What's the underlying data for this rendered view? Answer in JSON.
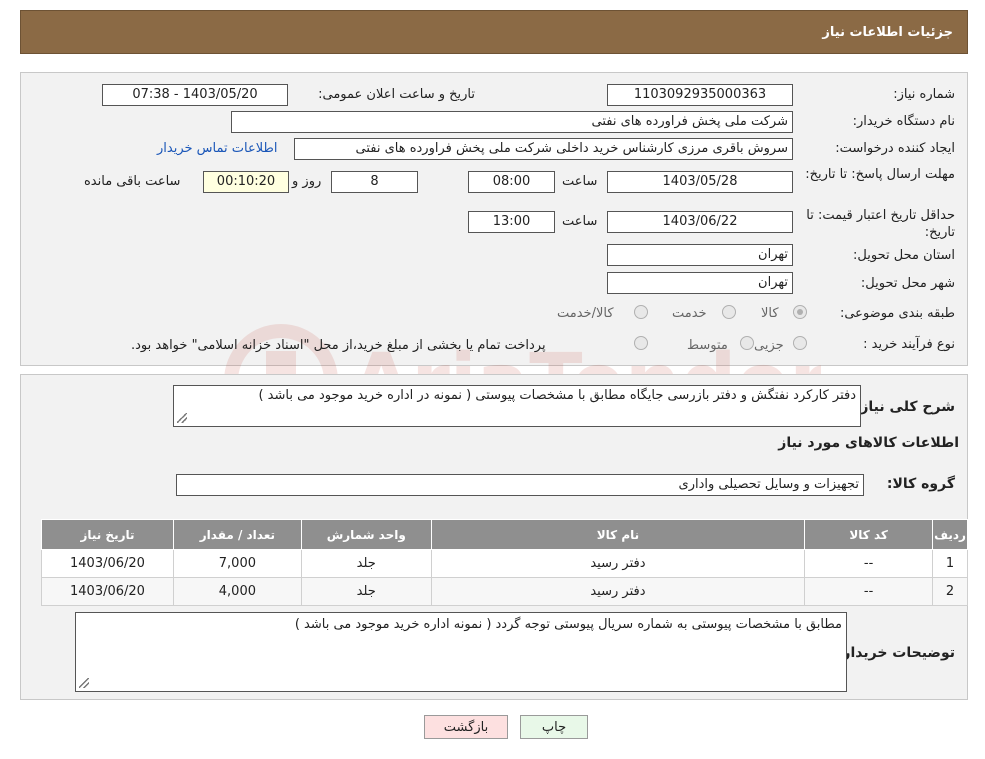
{
  "header": {
    "title": "جزئیات اطلاعات نیاز"
  },
  "details": {
    "need_number": {
      "label": "شماره نیاز:",
      "value": "1103092935000363"
    },
    "announce": {
      "label": "تاریخ و ساعت اعلان عمومی:",
      "value": "1403/05/20 - 07:38"
    },
    "buyer_org": {
      "label": "نام دستگاه خریدار:",
      "value": "شرکت ملی پخش فراورده های نفتی"
    },
    "requester": {
      "label": "ایجاد کننده درخواست:",
      "value": "سروش باقری مرزی کارشناس خرید داخلی شرکت ملی پخش فراورده های نفتی",
      "link": "اطلاعات تماس خریدار"
    },
    "reply_deadline": {
      "label": "مهلت ارسال پاسخ: تا تاریخ:",
      "date": "1403/05/28",
      "time_label": "ساعت",
      "time": "08:00",
      "days": "8",
      "days_label": "روز و",
      "remaining": "00:10:20",
      "remaining_label": "ساعت باقی مانده"
    },
    "price_validity": {
      "label": "حداقل تاریخ اعتبار قیمت: تا تاریخ:",
      "date": "1403/06/22",
      "time_label": "ساعت",
      "time": "13:00"
    },
    "province": {
      "label": "استان محل تحویل:",
      "value": "تهران"
    },
    "city": {
      "label": "شهر محل تحویل:",
      "value": "تهران"
    },
    "category": {
      "label": "طبقه بندی موضوعی:",
      "options": [
        "کالا",
        "خدمت",
        "کالا/خدمت"
      ]
    },
    "process": {
      "label": "نوع فرآیند خرید :",
      "options": [
        "جزیی",
        "متوسط"
      ],
      "note": "پرداخت تمام یا بخشی از مبلغ خرید،از محل \"اسناد خزانه اسلامی\" خواهد بود."
    }
  },
  "summary": {
    "label": "شرح کلی نیاز:",
    "value": "دفتر کارکرد نفتگش و دفتر بازرسی جایگاه مطابق با مشخصات پیوستی ( نمونه در اداره خرید موجود می باشد )"
  },
  "goods": {
    "title": "اطلاعات کالاهای مورد نیاز",
    "group_label": "گروه کالا:",
    "group_value": "تجهیزات و وسایل تحصیلی واداری",
    "columns": [
      "ردیف",
      "کد کالا",
      "نام کالا",
      "واحد شمارش",
      "تعداد / مقدار",
      "تاریخ نیاز"
    ],
    "rows": [
      [
        "1",
        "--",
        "دفتر رسید",
        "جلد",
        "7,000",
        "1403/06/20"
      ],
      [
        "2",
        "--",
        "دفتر رسید",
        "جلد",
        "4,000",
        "1403/06/20"
      ]
    ]
  },
  "buyer_notes": {
    "label": "توضیحات خریدار:",
    "value": "مطابق با مشخصات پیوستی به شماره سریال پیوستی توجه گردد ( نمونه اداره خرید موجود می باشد )"
  },
  "buttons": {
    "back": "بازگشت",
    "print": "چاپ"
  },
  "colors": {
    "header": "#8b6a45",
    "table_header": "#8f8f8f",
    "link": "#1a56b8",
    "watermark": "#c0392b"
  }
}
